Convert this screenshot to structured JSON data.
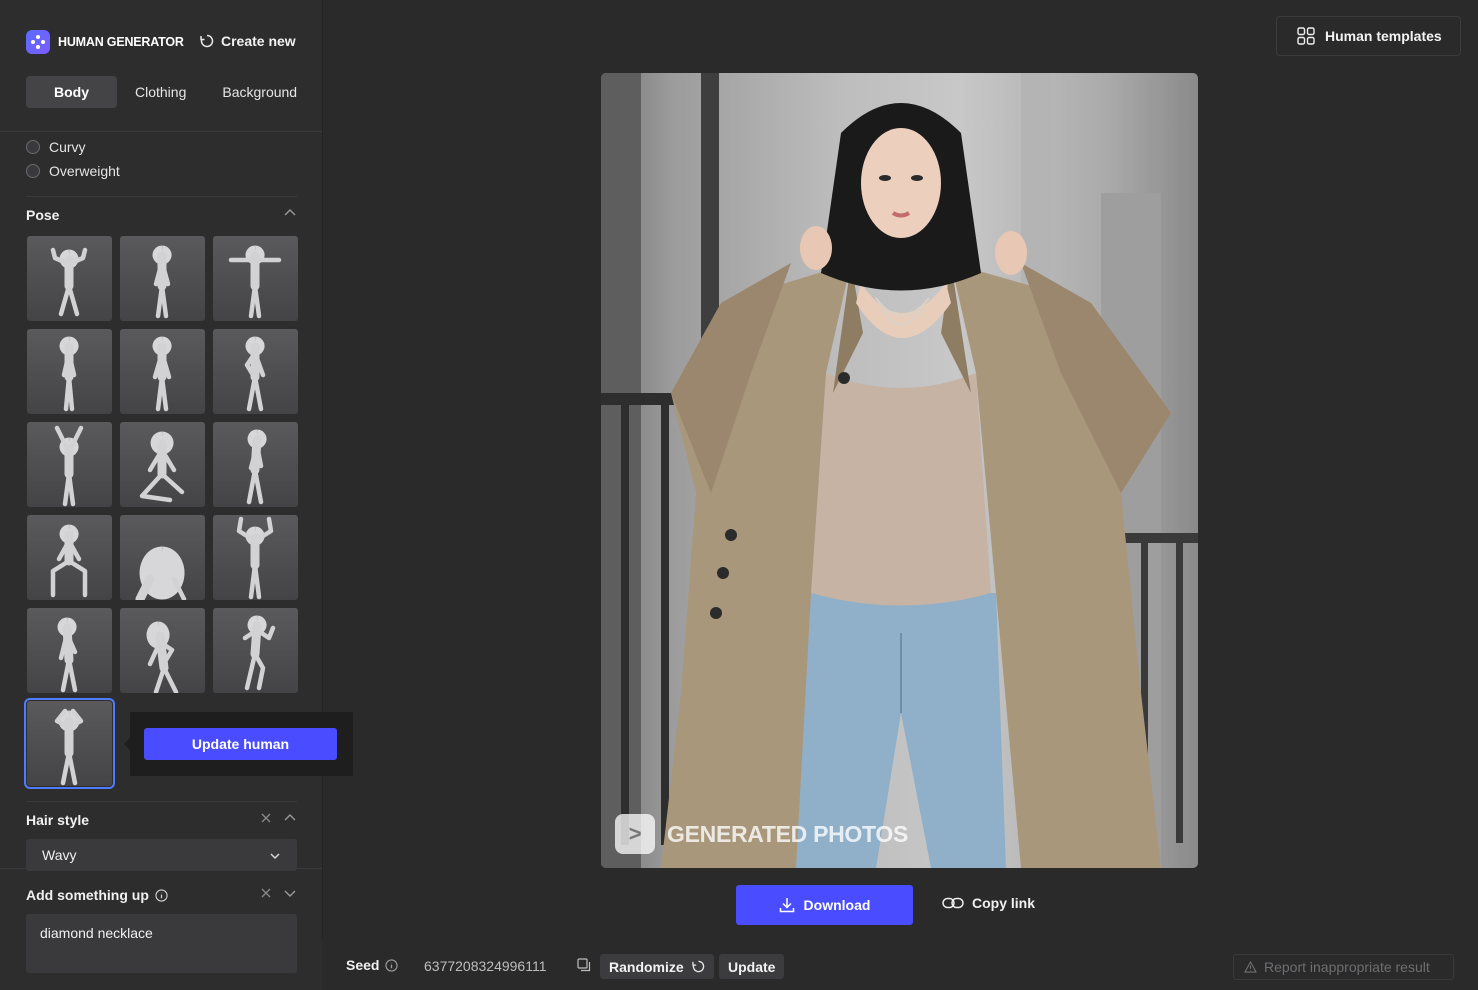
{
  "app": {
    "brand": "HUMAN GENERATOR",
    "create_new": "Create new"
  },
  "tabs": [
    {
      "label": "Body",
      "active": true
    },
    {
      "label": "Clothing",
      "active": false
    },
    {
      "label": "Background",
      "active": false
    }
  ],
  "body_types": [
    "Curvy",
    "Overweight"
  ],
  "pose": {
    "title": "Pose",
    "items": [
      "arms-flexed",
      "standing-neutral",
      "t-pose",
      "standing-slim",
      "standing-relaxed",
      "hand-on-hip",
      "arms-raised",
      "kneeling",
      "standing-side",
      "sitting",
      "head-closeup",
      "arms-up-bent",
      "contrapposto",
      "hand-on-chest",
      "dancing",
      "hands-on-head"
    ],
    "selected_index": 15
  },
  "tooltip": {
    "update_label": "Update human"
  },
  "hair_style": {
    "title": "Hair style",
    "value": "Wavy"
  },
  "add_something": {
    "title": "Add something up",
    "value": "diamond necklace"
  },
  "header": {
    "templates_label": "Human templates"
  },
  "photo": {
    "watermark": "GENERATED PHOTOS",
    "watermark_logo": ">"
  },
  "actions": {
    "download": "Download",
    "copy_link": "Copy link"
  },
  "footer": {
    "seed_label": "Seed",
    "seed_value": "6377208324996111",
    "randomize": "Randomize",
    "update": "Update",
    "report": "Report inappropriate result"
  },
  "colors": {
    "accent": "#4a4dff",
    "selected_outline": "#4e7bff",
    "background": "#2a2a2b"
  }
}
